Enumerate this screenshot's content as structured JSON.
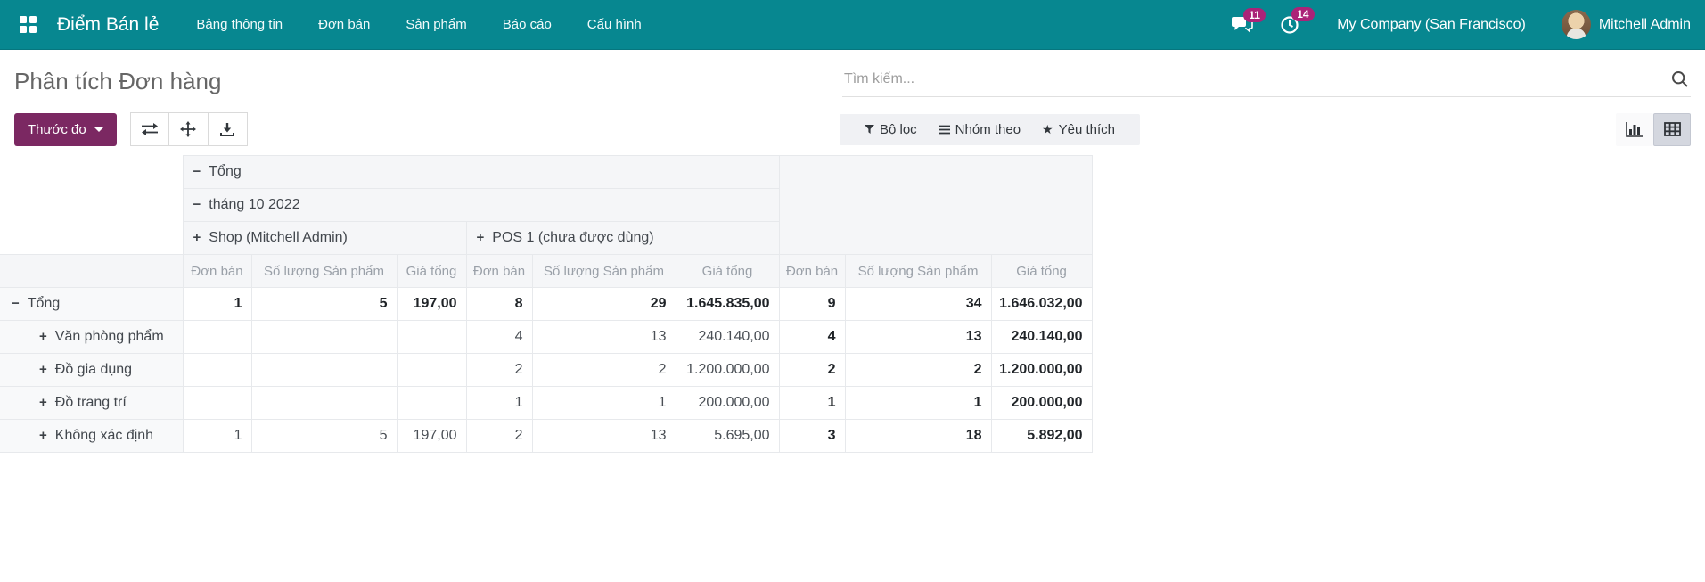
{
  "navbar": {
    "app_title": "Điểm Bán lẻ",
    "menu_items": [
      "Bảng thông tin",
      "Đơn bán",
      "Sản phẩm",
      "Báo cáo",
      "Cấu hình"
    ],
    "messages_badge": "11",
    "activities_badge": "14",
    "company_name": "My Company (San Francisco)",
    "user_name": "Mitchell Admin"
  },
  "colors": {
    "navbar_bg": "#078790",
    "badge_bg": "#ab2378",
    "primary_button_bg": "#7b2862",
    "active_view_bg": "#d4d7df"
  },
  "header": {
    "title": "Phân tích Đơn hàng",
    "search_placeholder": "Tìm kiếm..."
  },
  "toolbar": {
    "measures_label": "Thước đo",
    "filters_label": "Bộ lọc",
    "groupby_label": "Nhóm theo",
    "favorites_label": "Yêu thích"
  },
  "pivot": {
    "column_headers": {
      "total_label": "Tổng",
      "total_toggle": "−",
      "month_label": "tháng 10 2022",
      "month_toggle": "−",
      "group1_label": "Shop (Mitchell Admin)",
      "group1_toggle": "+",
      "group2_label": "POS 1 (chưa được dùng)",
      "group2_toggle": "+"
    },
    "measures": [
      "Đơn bán",
      "Số lượng Sản phẩm",
      "Giá tổng"
    ],
    "rows": [
      {
        "label": "Tổng",
        "toggle": "−",
        "cells": [
          "1",
          "5",
          "197,00",
          "8",
          "29",
          "1.645.835,00",
          "9",
          "34",
          "1.646.032,00"
        ]
      },
      {
        "label": "Văn phòng phẩm",
        "toggle": "+",
        "cells": [
          "",
          "",
          "",
          "4",
          "13",
          "240.140,00",
          "4",
          "13",
          "240.140,00"
        ]
      },
      {
        "label": "Đồ gia dụng",
        "toggle": "+",
        "cells": [
          "",
          "",
          "",
          "2",
          "2",
          "1.200.000,00",
          "2",
          "2",
          "1.200.000,00"
        ]
      },
      {
        "label": "Đồ trang trí",
        "toggle": "+",
        "cells": [
          "",
          "",
          "",
          "1",
          "1",
          "200.000,00",
          "1",
          "1",
          "200.000,00"
        ]
      },
      {
        "label": "Không xác định",
        "toggle": "+",
        "cells": [
          "1",
          "5",
          "197,00",
          "2",
          "13",
          "5.695,00",
          "3",
          "18",
          "5.892,00"
        ]
      }
    ]
  }
}
